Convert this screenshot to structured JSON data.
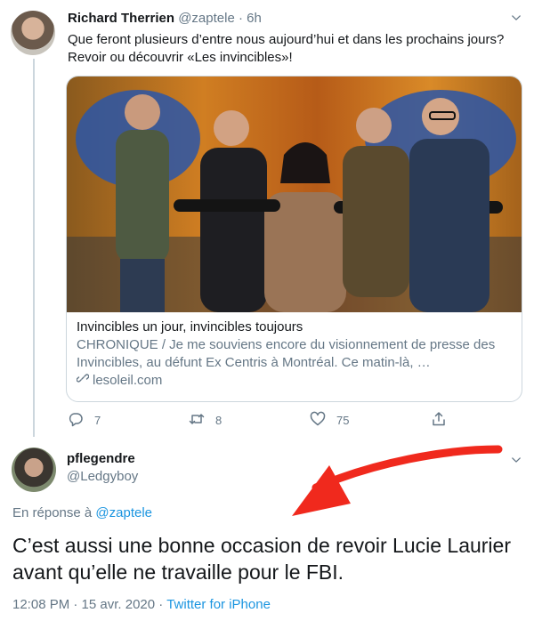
{
  "tweet": {
    "author_name": "Richard Therrien",
    "handle": "@zaptele",
    "separator": "·",
    "time": "6h",
    "text": "Que feront plusieurs d’entre nous aujourd’hui et dans les prochains jours? Revoir ou découvrir «Les invincibles»!",
    "card": {
      "title": "Invincibles un jour, invincibles toujours",
      "description": "CHRONIQUE / Je me souviens encore du visionnement de presse des Invincibles, au défunt Ex Centris à Montréal. Ce matin-là, …",
      "domain": "lesoleil.com"
    },
    "actions": {
      "reply_count": "7",
      "retweet_count": "8",
      "like_count": "75"
    }
  },
  "reply": {
    "author_name": "pflegendre",
    "handle": "@Ledgyboy",
    "reply_prefix": "En réponse à",
    "reply_to": "@zaptele",
    "text": "C’est aussi une bonne occasion de revoir Lucie Laurier avant qu’elle ne travaille pour le FBI.",
    "timestamp": "12:08 PM · 15 avr. 2020",
    "source_separator": "·",
    "source": "Twitter for iPhone"
  },
  "colors": {
    "link": "#1b95e0",
    "secondary_text": "#657786",
    "annotation_arrow": "#f0291d"
  },
  "icons": [
    "caret-down-icon",
    "reply-icon",
    "retweet-icon",
    "like-icon",
    "share-icon",
    "link-icon"
  ]
}
